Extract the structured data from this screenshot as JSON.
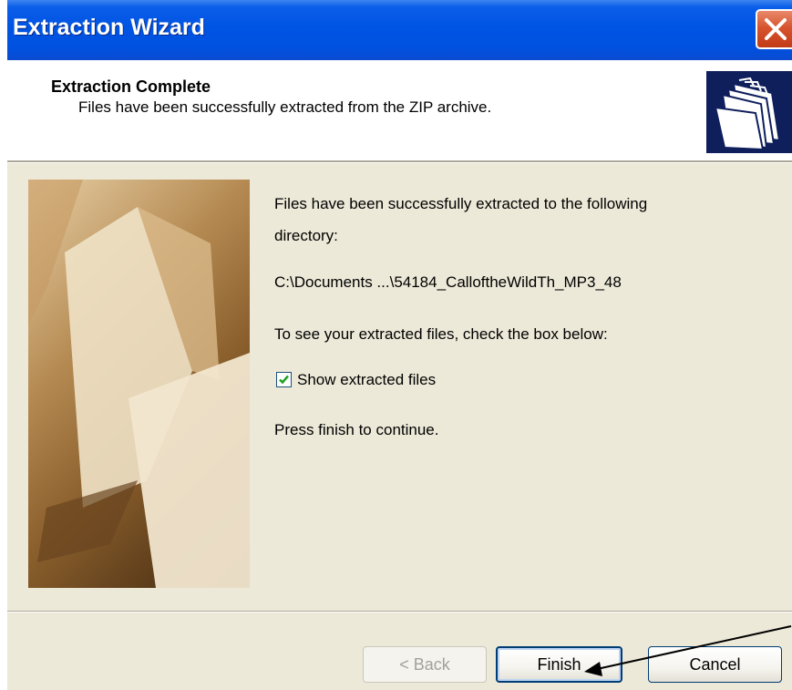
{
  "window": {
    "title": "Extraction Wizard"
  },
  "header": {
    "title": "Extraction Complete",
    "subtitle": "Files have been successfully extracted from the ZIP archive.",
    "icon": "folders-icon"
  },
  "content": {
    "line1": "Files have been successfully extracted to the following",
    "line2": "directory:",
    "path": "C:\\Documents ...\\54184_CalloftheWildTh_MP3_48",
    "instruction": "To see your extracted files, check the box below:",
    "checkbox": {
      "label": "Show extracted files",
      "checked": true
    },
    "continue_text": "Press finish to continue."
  },
  "buttons": {
    "back": "< Back",
    "finish": "Finish",
    "cancel": "Cancel"
  },
  "colors": {
    "titlebar": "#0054e3",
    "dialog_bg": "#ece9d8",
    "close": "#d6542f",
    "check": "#21a121"
  }
}
